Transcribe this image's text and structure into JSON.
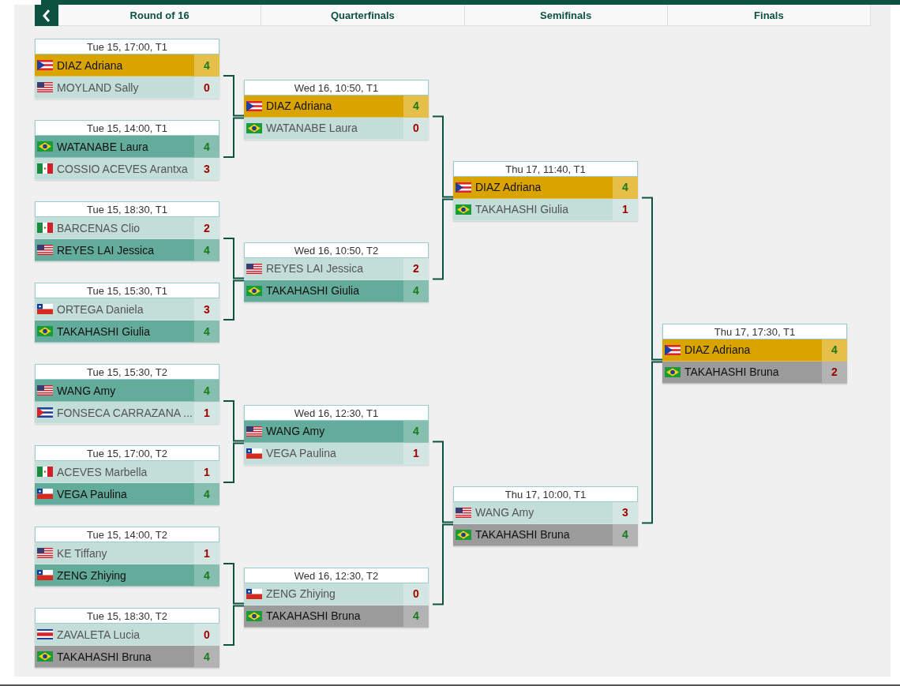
{
  "rounds": [
    {
      "title": "Round of 16",
      "matches": [
        {
          "time": "Tue 15, 17:00, T1",
          "players": [
            {
              "name": "DIAZ Adriana",
              "kind": "pur",
              "score": "4",
              "won": true,
              "gold": true,
              "silver": false
            },
            {
              "name": "MOYLAND Sally",
              "kind": "usa",
              "score": "0",
              "won": false,
              "gold": false,
              "silver": false
            }
          ]
        },
        {
          "time": "Tue 15, 14:00, T1",
          "players": [
            {
              "name": "WATANABE Laura",
              "kind": "bra",
              "score": "4",
              "won": true,
              "gold": false,
              "silver": false
            },
            {
              "name": "COSSIO ACEVES Arantxa",
              "kind": "mex",
              "score": "3",
              "won": false,
              "gold": false,
              "silver": false
            }
          ]
        },
        {
          "time": "Tue 15, 18:30, T1",
          "players": [
            {
              "name": "BARCENAS Clio",
              "kind": "mex",
              "score": "2",
              "won": false,
              "gold": false,
              "silver": false
            },
            {
              "name": "REYES LAI Jessica",
              "kind": "usa",
              "score": "4",
              "won": true,
              "gold": false,
              "silver": false
            }
          ]
        },
        {
          "time": "Tue 15, 15:30, T1",
          "players": [
            {
              "name": "ORTEGA Daniela",
              "kind": "chi",
              "score": "3",
              "won": false,
              "gold": false,
              "silver": false
            },
            {
              "name": "TAKAHASHI Giulia",
              "kind": "bra",
              "score": "4",
              "won": true,
              "gold": false,
              "silver": false
            }
          ]
        },
        {
          "time": "Tue 15, 15:30, T2",
          "players": [
            {
              "name": "WANG Amy",
              "kind": "usa",
              "score": "4",
              "won": true,
              "gold": false,
              "silver": false
            },
            {
              "name": "FONSECA CARRAZANA ...",
              "kind": "cub",
              "score": "1",
              "won": false,
              "gold": false,
              "silver": false
            }
          ]
        },
        {
          "time": "Tue 15, 17:00, T2",
          "players": [
            {
              "name": "ACEVES Marbella",
              "kind": "mex",
              "score": "1",
              "won": false,
              "gold": false,
              "silver": false
            },
            {
              "name": "VEGA Paulina",
              "kind": "chi",
              "score": "4",
              "won": true,
              "gold": false,
              "silver": false
            }
          ]
        },
        {
          "time": "Tue 15, 14:00, T2",
          "players": [
            {
              "name": "KE Tiffany",
              "kind": "usa",
              "score": "1",
              "won": false,
              "gold": false,
              "silver": false
            },
            {
              "name": "ZENG Zhiying",
              "kind": "chi",
              "score": "4",
              "won": true,
              "gold": false,
              "silver": false
            }
          ]
        },
        {
          "time": "Tue 15, 18:30, T2",
          "players": [
            {
              "name": "ZAVALETA Lucia",
              "kind": "crc",
              "score": "0",
              "won": false,
              "gold": false,
              "silver": false
            },
            {
              "name": "TAKAHASHI Bruna",
              "kind": "bra",
              "score": "4",
              "won": true,
              "gold": false,
              "silver": true
            }
          ]
        }
      ]
    },
    {
      "title": "Quarterfinals",
      "matches": [
        {
          "time": "Wed 16, 10:50, T1",
          "players": [
            {
              "name": "DIAZ Adriana",
              "kind": "pur",
              "score": "4",
              "won": true,
              "gold": true,
              "silver": false
            },
            {
              "name": "WATANABE Laura",
              "kind": "bra",
              "score": "0",
              "won": false,
              "gold": false,
              "silver": false
            }
          ]
        },
        {
          "time": "Wed 16, 10:50, T2",
          "players": [
            {
              "name": "REYES LAI Jessica",
              "kind": "usa",
              "score": "2",
              "won": false,
              "gold": false,
              "silver": false
            },
            {
              "name": "TAKAHASHI Giulia",
              "kind": "bra",
              "score": "4",
              "won": true,
              "gold": false,
              "silver": false
            }
          ]
        },
        {
          "time": "Wed 16, 12:30, T1",
          "players": [
            {
              "name": "WANG Amy",
              "kind": "usa",
              "score": "4",
              "won": true,
              "gold": false,
              "silver": false
            },
            {
              "name": "VEGA Paulina",
              "kind": "chi",
              "score": "1",
              "won": false,
              "gold": false,
              "silver": false
            }
          ]
        },
        {
          "time": "Wed 16, 12:30, T2",
          "players": [
            {
              "name": "ZENG Zhiying",
              "kind": "chi",
              "score": "0",
              "won": false,
              "gold": false,
              "silver": false
            },
            {
              "name": "TAKAHASHI Bruna",
              "kind": "bra",
              "score": "4",
              "won": true,
              "gold": false,
              "silver": true
            }
          ]
        }
      ]
    },
    {
      "title": "Semifinals",
      "matches": [
        {
          "time": "Thu 17, 11:40, T1",
          "players": [
            {
              "name": "DIAZ Adriana",
              "kind": "pur",
              "score": "4",
              "won": true,
              "gold": true,
              "silver": false
            },
            {
              "name": "TAKAHASHI Giulia",
              "kind": "bra",
              "score": "1",
              "won": false,
              "gold": false,
              "silver": false
            }
          ]
        },
        {
          "time": "Thu 17, 10:00, T1",
          "players": [
            {
              "name": "WANG Amy",
              "kind": "usa",
              "score": "3",
              "won": false,
              "gold": false,
              "silver": false
            },
            {
              "name": "TAKAHASHI Bruna",
              "kind": "bra",
              "score": "4",
              "won": true,
              "gold": false,
              "silver": true
            }
          ]
        }
      ]
    },
    {
      "title": "Finals",
      "matches": [
        {
          "time": "Thu 17, 17:30, T1",
          "players": [
            {
              "name": "DIAZ Adriana",
              "kind": "pur",
              "score": "4",
              "won": true,
              "gold": true,
              "silver": false
            },
            {
              "name": "TAKAHASHI Bruna",
              "kind": "bra",
              "score": "2",
              "won": false,
              "gold": false,
              "silver": true
            }
          ]
        }
      ]
    }
  ]
}
